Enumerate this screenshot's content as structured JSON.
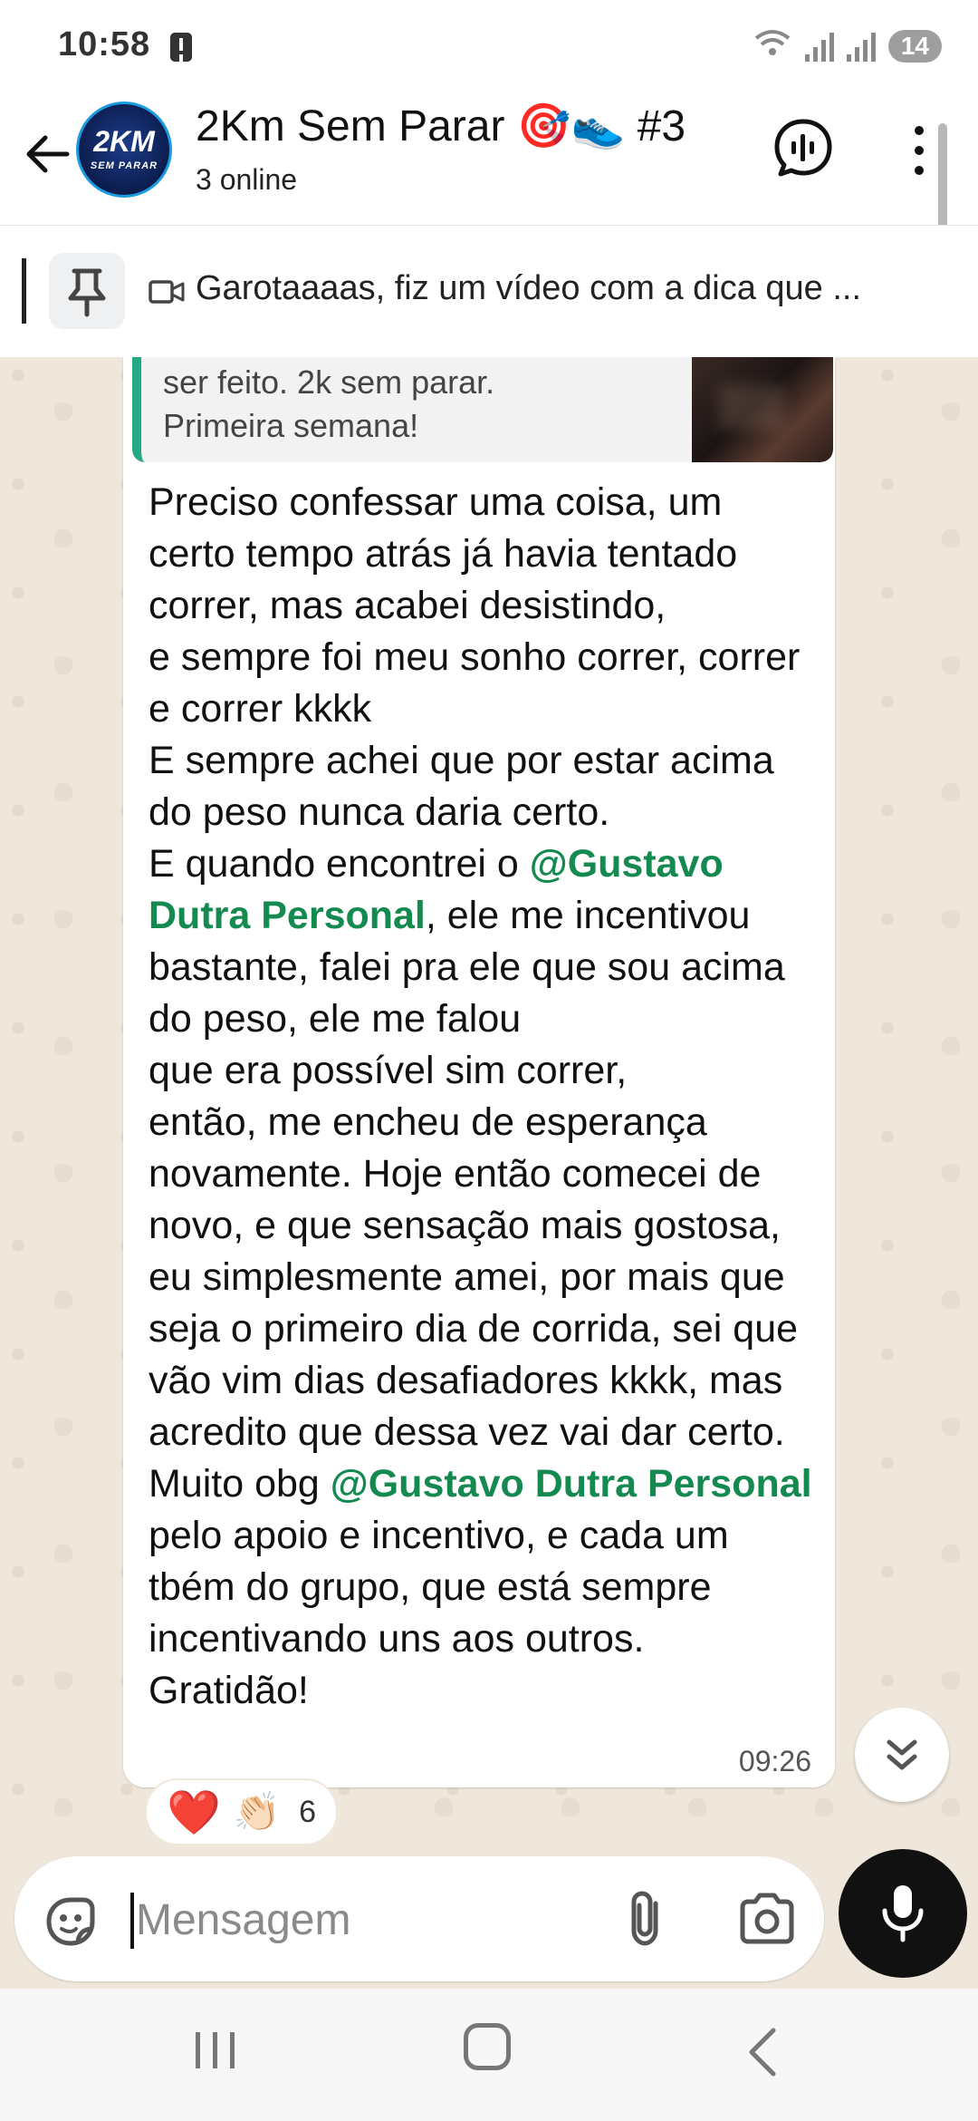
{
  "status_bar": {
    "time": "10:58",
    "battery": "14"
  },
  "header": {
    "avatar_text_main": "2KM",
    "avatar_text_sub": "SEM PARAR",
    "title": "2Km Sem Parar 🎯👟 #3",
    "subtitle": "3 online"
  },
  "pinned": {
    "text": "Garotaaaas, fiz um vídeo com a dica que ..."
  },
  "message": {
    "quote_text": "ser feito. 2k sem parar.\nPrimeira semana!",
    "mention": "@Gustavo Dutra Personal",
    "part1": "Preciso confessar uma coisa, um certo tempo atrás já havia tentado correr, mas acabei desistindo,\ne sempre foi meu sonho correr, correr e correr kkkk\nE sempre achei que por estar acima do peso nunca daria certo.\nE quando encontrei o ",
    "part2": ", ele me incentivou bastante, falei pra ele que sou acima do peso, ele me falou\nque era possível sim correr,\nentão, me encheu de esperança novamente. Hoje então comecei de novo, e que sensação mais gostosa, eu simplesmente amei, por mais que seja o primeiro dia de corrida, sei que vão vim dias desafiadores kkkk, mas acredito que dessa vez vai dar certo. Muito obg ",
    "part3": "\npelo apoio e incentivo, e cada um tbém do grupo, que está sempre incentivando uns aos outros.\nGratidão!",
    "time": "09:26"
  },
  "reactions": {
    "emoji1": "❤️",
    "emoji2": "👏🏻",
    "count": "6"
  },
  "input": {
    "placeholder": "Mensagem"
  },
  "colors": {
    "mention": "#158a50",
    "quote_bar": "#25a884",
    "chat_bg": "#efe7db"
  }
}
